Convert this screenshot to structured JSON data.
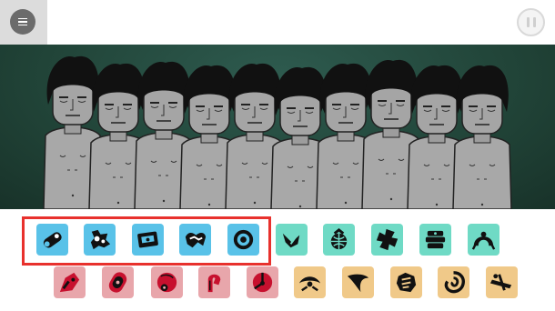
{
  "app": {
    "menu_icon": "hamburger-icon",
    "pause_icon": "pause-icon"
  },
  "stage": {
    "background_color": "#214438",
    "performer_count": 10
  },
  "palette": {
    "selection_color": "#e8312d",
    "groups": {
      "beats": {
        "color": "#59c2e8",
        "icons": [
          "pill-icon",
          "puzzle-icon",
          "box-icon",
          "wave-icon",
          "target-icon"
        ]
      },
      "effects": {
        "color": "#6fdac5",
        "icons": [
          "bird-icon",
          "globe-bag-icon",
          "cross-icon",
          "stack-icon",
          "arc-icon"
        ]
      },
      "melodies": {
        "color": "#e8a6ab",
        "icons": [
          "shard-icon",
          "capsule-icon",
          "ball-icon",
          "hook-icon",
          "disc-icon"
        ]
      },
      "voices": {
        "color": "#f0c989",
        "icons": [
          "eye-icon",
          "curve-icon",
          "hand-icon",
          "swirl-icon",
          "lever-icon"
        ]
      }
    }
  }
}
